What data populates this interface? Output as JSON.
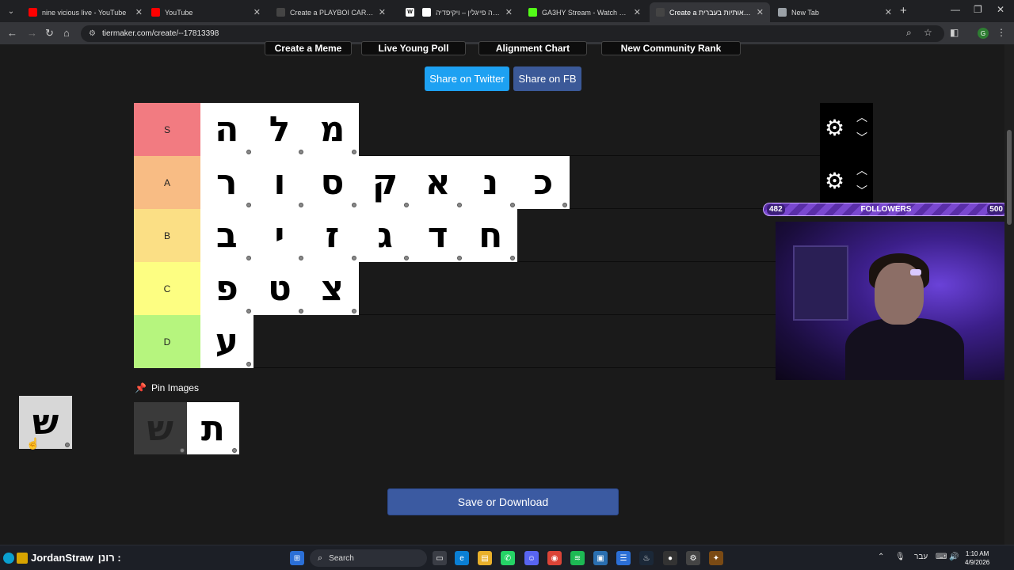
{
  "browser": {
    "tabs": [
      {
        "title": "nine vicious live - YouTube",
        "icon": "youtube-icon",
        "color": "#ff0000",
        "active": false
      },
      {
        "title": "YouTube",
        "icon": "youtube-icon",
        "color": "#ff0000",
        "active": false
      },
      {
        "title": "Create a PLAYBOI CARTI SONG",
        "icon": "tiermaker-icon",
        "color": "#444444",
        "active": false
      },
      {
        "title": "W",
        "icon": "wikipedia-icon",
        "color": "#ffffff",
        "active": false
      },
      {
        "title": "משה פייגלין – ויקיפדיה",
        "icon": "wikipedia-icon",
        "color": "#ffffff",
        "active": false
      },
      {
        "title": "GA3HY Stream - Watch Live on",
        "icon": "kick-icon",
        "color": "#53fc18",
        "active": false
      },
      {
        "title": "Create a אותיות בעברית Tier Li",
        "icon": "tiermaker-icon",
        "color": "#444444",
        "active": true
      },
      {
        "title": "New Tab",
        "icon": "globe-icon",
        "color": "#9aa0a6",
        "active": false
      }
    ],
    "url": "tiermaker.com/create/--17813398"
  },
  "page": {
    "top_buttons": [
      "Create a Meme",
      "Live Young Poll",
      "Alignment Chart",
      "New Community Rank"
    ],
    "share_twitter": "Share on Twitter",
    "share_fb": "Share on FB",
    "pin_images": "Pin Images",
    "save_download": "Save or Download"
  },
  "tiers": [
    {
      "label": "S",
      "color": "#f27b81",
      "items": [
        "ה",
        "ל",
        "מ"
      ],
      "controls": true
    },
    {
      "label": "A",
      "color": "#f8bc84",
      "items": [
        "ר",
        "ו",
        "ס",
        "ק",
        "א",
        "נ",
        "כ"
      ],
      "controls": true
    },
    {
      "label": "B",
      "color": "#fbdf85",
      "items": [
        "ב",
        "י",
        "ז",
        "ג",
        "ד",
        "ח"
      ],
      "controls": false
    },
    {
      "label": "C",
      "color": "#fdfe82",
      "items": [
        "פ",
        "ט",
        "צ"
      ],
      "controls": false
    },
    {
      "label": "D",
      "color": "#b6f57e",
      "items": [
        "ע"
      ],
      "controls": false
    }
  ],
  "pool": {
    "items": [
      {
        "char": "ש",
        "ghost": true
      },
      {
        "char": "ת",
        "ghost": false
      }
    ],
    "dragging": "ש"
  },
  "stream_overlay": {
    "followers_label": "FOLLOWERS",
    "followers_current": "482",
    "followers_goal": "500"
  },
  "taskbar": {
    "chat_user": "JordanStraw",
    "chat_message": "רונן :",
    "search_placeholder": "Search",
    "lang": "עבר",
    "time": "1:10 AM",
    "date": "4/9/2026"
  }
}
